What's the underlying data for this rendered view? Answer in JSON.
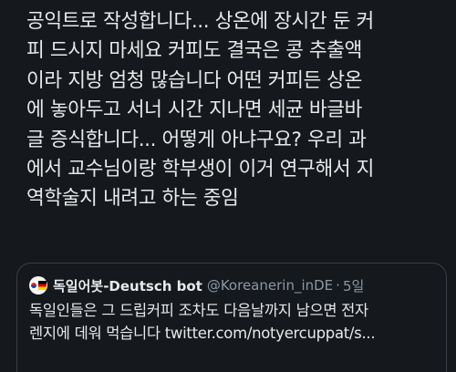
{
  "post": {
    "lines": [
      "공익트로 작성합니다... 상온에 장시간 둔 커",
      "피 드시지 마세요 커피도 결국은 콩 추출액",
      "이라 지방 엄청 많습니다 어떤 커피든 상온",
      "에 놓아두고 서너 시간 지나면 세균 바글바",
      "글 증식합니다... 어떻게 아냐구요? 우리 과",
      "에서 교수님이랑 학부생이 이거 연구해서 지",
      "역학술지 내려고 하는 중임"
    ]
  },
  "quoted_tweet": {
    "avatar_icon": "korea-germany-flags-icon",
    "display_name": "독일어봇-Deutsch bot",
    "handle": "@Koreanerin_inDE",
    "separator": "·",
    "age": "5일",
    "text_lines": [
      "독일인들은 그 드립커피 조차도 다음날까지 남으면 전자",
      "렌지에 데워 먹습니다 twitter.com/notyercuppat/s..."
    ]
  },
  "colors": {
    "background": "#15181c",
    "text": "#e7e9ea",
    "secondary_text": "#8b98a5",
    "card_border": "#3a3f45"
  }
}
